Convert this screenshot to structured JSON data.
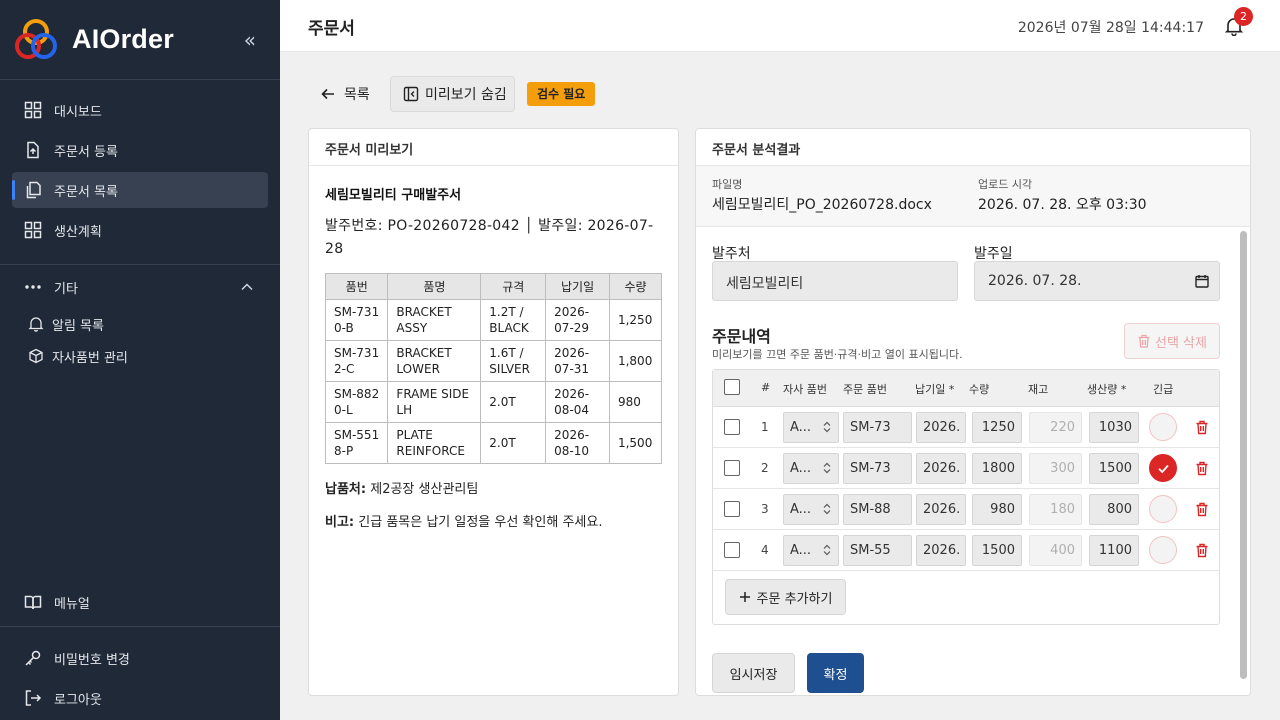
{
  "app": {
    "name": "AIOrder",
    "collapse_glyph": "«"
  },
  "sidebar": {
    "items": [
      {
        "label": "대시보드",
        "icon": "dashboard-icon"
      },
      {
        "label": "주문서 등록",
        "icon": "upload-file-icon"
      },
      {
        "label": "주문서 목록",
        "icon": "copy-file-icon",
        "active": true
      },
      {
        "label": "생산계획",
        "icon": "grid-icon"
      }
    ],
    "group": {
      "label": "기타",
      "sub_items": [
        {
          "label": "알림 목록"
        },
        {
          "label": "자사품번 관리"
        }
      ]
    },
    "manual_label": "메뉴얼",
    "password_label": "비밀번호 변경",
    "logout_label": "로그아웃"
  },
  "header": {
    "title": "주문서",
    "datetime": "2026년 07월 28일 14:44:17",
    "notification_count": "2"
  },
  "actions": {
    "back_label": "목록",
    "preview_toggle_label": "미리보기 숨김",
    "status_badge": "검수 필요"
  },
  "preview": {
    "header": "주문서 미리보기",
    "doc_title": "세림모빌리티 구매발주서",
    "doc_meta": "발주번호: PO-20260728-042  │  발주일: 2026-07-28",
    "table": {
      "columns": [
        "품번",
        "품명",
        "규격",
        "납기일",
        "수량"
      ],
      "rows": [
        [
          "SM-7310-B",
          "BRACKET ASSY",
          "1.2T / BLACK",
          "2026-07-29",
          "1,250"
        ],
        [
          "SM-7312-C",
          "BRACKET LOWER",
          "1.6T / SILVER",
          "2026-07-31",
          "1,800"
        ],
        [
          "SM-8820-L",
          "FRAME SIDE LH",
          "2.0T",
          "2026-08-04",
          "980"
        ],
        [
          "SM-5518-P",
          "PLATE REINFORCE",
          "2.0T",
          "2026-08-10",
          "1,500"
        ]
      ]
    },
    "delivery_label": "납품처:",
    "delivery_value": "제2공장 생산관리팀",
    "note_label": "비고:",
    "note_value": "긴급 품목은 납기 일정을 우선 확인해 주세요."
  },
  "analysis": {
    "header": "주문서 분석결과",
    "file_label": "파일명",
    "file_value": "세림모빌리티_PO_20260728.docx",
    "upload_label": "업로드 시각",
    "upload_value": "2026. 07. 28. 오후 03:30",
    "client_label": "발주처",
    "client_value": "세림모빌리티",
    "order_date_label": "발주일",
    "order_date_value": "2026. 07. 28.",
    "section_title": "주문내역",
    "section_hint": "미리보기를 끄면 주문 품번·규격·비고 열이 표시됩니다.",
    "delete_selected_label": "선택 삭제",
    "columns": {
      "num": "#",
      "own_part": "자사 품번",
      "order_part": "주문 품번",
      "due": "납기일 *",
      "qty": "수량",
      "stock": "재고",
      "production": "생산량 *",
      "urgent": "긴급"
    },
    "rows": [
      {
        "num": "1",
        "own_part": "A...",
        "order_part": "SM-73",
        "due": "2026.",
        "qty": "1250",
        "stock": "220",
        "production": "1030",
        "urgent": false
      },
      {
        "num": "2",
        "own_part": "A...",
        "order_part": "SM-73",
        "due": "2026.",
        "qty": "1800",
        "stock": "300",
        "production": "1500",
        "urgent": true
      },
      {
        "num": "3",
        "own_part": "A...",
        "order_part": "SM-88",
        "due": "2026.",
        "qty": "980",
        "stock": "180",
        "production": "800",
        "urgent": false
      },
      {
        "num": "4",
        "own_part": "A...",
        "order_part": "SM-55",
        "due": "2026.",
        "qty": "1500",
        "stock": "400",
        "production": "1100",
        "urgent": false
      }
    ],
    "add_row_label": "주문 추가하기",
    "save_label": "임시저장",
    "confirm_label": "확정"
  },
  "colors": {
    "sidebar_bg": "#1f2937",
    "accent": "#3b82f6",
    "badge": "#f59e0b",
    "danger": "#dc2626",
    "primary": "#1e4f91"
  }
}
